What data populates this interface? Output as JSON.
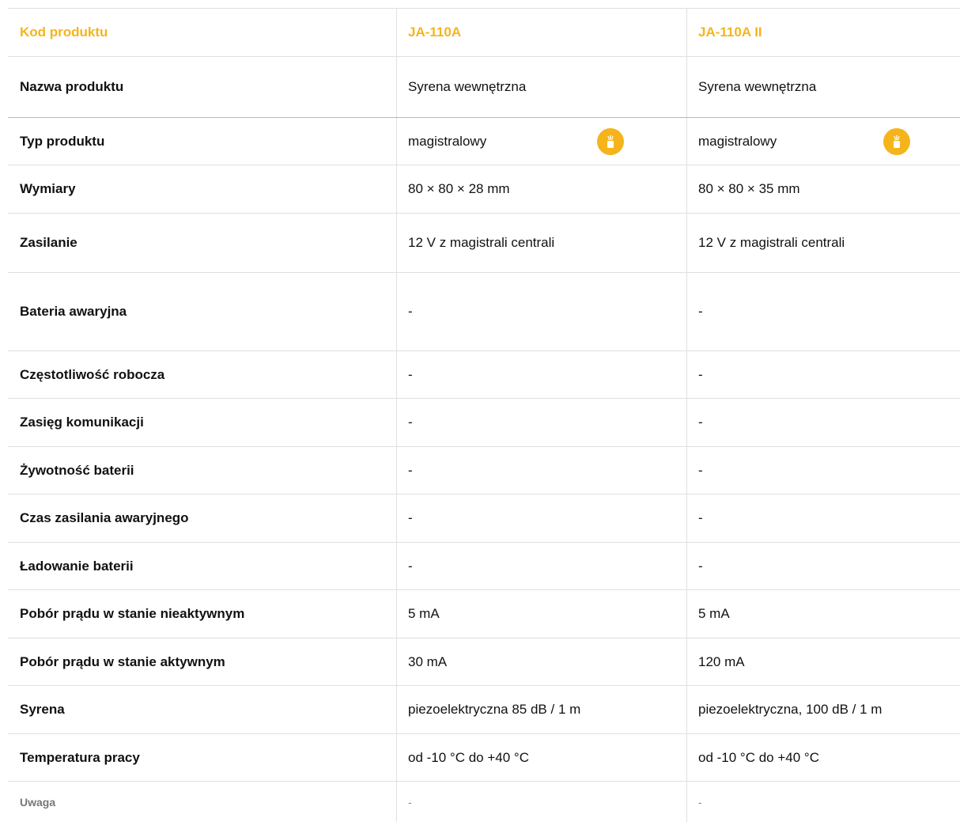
{
  "colors": {
    "accent": "#f6b41c",
    "border": "#e0e0e0",
    "text": "#111111",
    "muted": "#888888"
  },
  "header": {
    "label": "Kod produktu",
    "col1": "JA-110A",
    "col2": "JA-110A II"
  },
  "rows": [
    {
      "label": "Nazwa produktu",
      "col1": "Syrena wewnętrzna",
      "col2": "Syrena wewnętrzna"
    },
    {
      "label": "Typ produktu",
      "col1": "magistralowy",
      "col2": "magistralowy",
      "icon": "wired-bus-icon"
    },
    {
      "label": "Wymiary",
      "col1": "80 × 80 × 28 mm",
      "col2": "80 × 80 × 35 mm"
    },
    {
      "label": "Zasilanie",
      "col1": "12 V z magistrali centrali",
      "col2": "12 V z magistrali centrali"
    },
    {
      "label": "Bateria awaryjna",
      "col1": "-",
      "col2": "-"
    },
    {
      "label": "Częstotliwość robocza",
      "col1": "-",
      "col2": "-"
    },
    {
      "label": "Zasięg komunikacji",
      "col1": "-",
      "col2": "-"
    },
    {
      "label": "Żywotność baterii",
      "col1": "-",
      "col2": "-"
    },
    {
      "label": "Czas zasilania awaryjnego",
      "col1": "-",
      "col2": "-"
    },
    {
      "label": "Ładowanie baterii",
      "col1": "-",
      "col2": "-"
    },
    {
      "label": "Pobór prądu w stanie nieaktywnym",
      "col1": "5 mA",
      "col2": "5 mA"
    },
    {
      "label": "Pobór prądu w stanie aktywnym",
      "col1": "30 mA",
      "col2": "120 mA"
    },
    {
      "label": "Syrena",
      "col1": "piezoelektryczna 85 dB / 1 m",
      "col2": "piezoelektryczna, 100 dB / 1 m"
    },
    {
      "label": "Temperatura pracy",
      "col1": "od -10 °C do +40 °C",
      "col2": "od -10 °C do +40 °C"
    },
    {
      "label": "Uwaga",
      "col1": "-",
      "col2": "-"
    }
  ]
}
